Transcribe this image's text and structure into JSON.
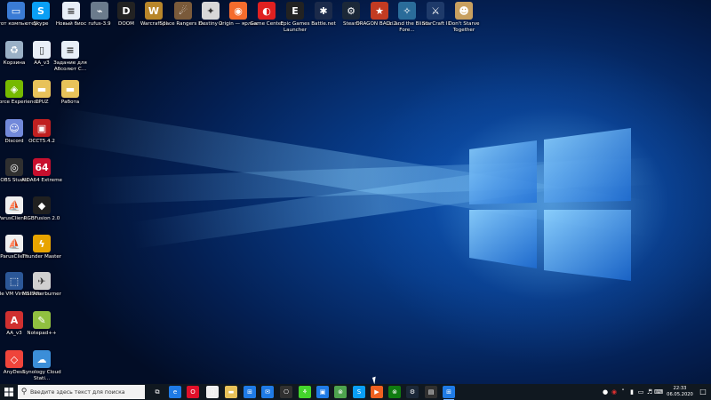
{
  "desktop_icons": [
    {
      "label": "Этот компьютер",
      "icon": "computer-icon",
      "color": "#3a7bd5"
    },
    {
      "label": "Skype",
      "icon": "skype-icon",
      "color": "#0a9ff5"
    },
    {
      "label": "Новый биос",
      "icon": "document-icon",
      "color": "#e8eef7"
    },
    {
      "label": "rufus-3.9",
      "icon": "usb-drive-icon",
      "color": "#6b7b8c"
    },
    {
      "label": "DOOM",
      "icon": "doom-logo-icon",
      "color": "#222222"
    },
    {
      "label": "Warcraft III",
      "icon": "warcraft-icon",
      "color": "#b8862a"
    },
    {
      "label": "Space Rangers H...",
      "icon": "space-rangers-icon",
      "color": "#7a5a3a"
    },
    {
      "label": "Destiny 2",
      "icon": "destiny-icon",
      "color": "#d8d8d8"
    },
    {
      "label": "Origin — ярлык",
      "icon": "origin-icon",
      "color": "#f56c2d"
    },
    {
      "label": "Game Center",
      "icon": "game-center-icon",
      "color": "#e02020"
    },
    {
      "label": "Epic Games Launcher",
      "icon": "epic-games-icon",
      "color": "#222222"
    },
    {
      "label": "Battle.net",
      "icon": "battlenet-icon",
      "color": "#1b2a4a"
    },
    {
      "label": "Steam",
      "icon": "steam-icon",
      "color": "#1b2838"
    },
    {
      "label": "DRAGON BALL Z ...",
      "icon": "dragon-ball-icon",
      "color": "#c23b22"
    },
    {
      "label": "Ori and the Blind Fore...",
      "icon": "ori-icon",
      "color": "#2a6c9a"
    },
    {
      "label": "StarCraft II",
      "icon": "starcraft-icon",
      "color": "#1e3a6a"
    },
    {
      "label": "Don't Starve Together",
      "icon": "dont-starve-icon",
      "color": "#c8a060"
    },
    {
      "label": "Корзина",
      "icon": "recycle-bin-icon",
      "color": "#9ab0c6"
    },
    {
      "label": "AA_v3",
      "icon": "file-icon",
      "color": "#e8eef7"
    },
    {
      "label": "Задание для Абсолют С...",
      "icon": "document-icon",
      "color": "#e8eef7"
    },
    {
      "label": "GeForce Experience",
      "icon": "geforce-icon",
      "color": "#76b900"
    },
    {
      "label": "CPUZ",
      "icon": "folder-icon",
      "color": "#e8c25a"
    },
    {
      "label": "Работа",
      "icon": "folder-icon",
      "color": "#e8c25a"
    },
    {
      "label": "Discord",
      "icon": "discord-icon",
      "color": "#7289da"
    },
    {
      "label": "OCCT5.4.2",
      "icon": "occt-icon",
      "color": "#c02020"
    },
    {
      "label": "OBS Studio",
      "icon": "obs-icon",
      "color": "#303030"
    },
    {
      "label": "AIDA64 Extreme",
      "icon": "aida64-icon",
      "color": "#c8102e"
    },
    {
      "label": "ParusClient...",
      "icon": "parus-icon",
      "color": "#f0f0f0"
    },
    {
      "label": "RGBFusion 2.0",
      "icon": "rgb-fusion-icon",
      "color": "#202020"
    },
    {
      "label": "ParusClient",
      "icon": "parus-icon",
      "color": "#f0f0f0"
    },
    {
      "label": "Thunder Master",
      "icon": "thunder-master-icon",
      "color": "#e8a400"
    },
    {
      "label": "Oracle VM VirtualBox",
      "icon": "virtualbox-icon",
      "color": "#2b5797"
    },
    {
      "label": "MSI Afterburner",
      "icon": "msi-afterburner-icon",
      "color": "#d0d0d0"
    },
    {
      "label": "AA_v3",
      "icon": "aa-v3-icon",
      "color": "#d03030"
    },
    {
      "label": "Notepad++",
      "icon": "notepadpp-icon",
      "color": "#90c040"
    },
    {
      "label": "AnyDesk",
      "icon": "anydesk-icon",
      "color": "#ef443b"
    },
    {
      "label": "Synology Cloud Stati...",
      "icon": "synology-icon",
      "color": "#3b8ed8"
    }
  ],
  "taskbar": {
    "search_placeholder": "Введите здесь текст для поиска",
    "apps": [
      {
        "name": "task-view",
        "icon": "task-view-icon",
        "color": "#101820"
      },
      {
        "name": "edge",
        "icon": "edge-icon",
        "color": "#1f7be6"
      },
      {
        "name": "opera",
        "icon": "opera-icon",
        "color": "#e0102a"
      },
      {
        "name": "tablet",
        "icon": "tablet-icon",
        "color": "#f0f0f0"
      },
      {
        "name": "file-explorer",
        "icon": "file-explorer-icon",
        "color": "#e8c25a"
      },
      {
        "name": "store",
        "icon": "store-icon",
        "color": "#1f7be6"
      },
      {
        "name": "mail",
        "icon": "mail-icon",
        "color": "#1f7be6"
      },
      {
        "name": "game",
        "icon": "gamepad-icon",
        "color": "#303030"
      },
      {
        "name": "razer",
        "icon": "razer-icon",
        "color": "#44d62c"
      },
      {
        "name": "photos",
        "icon": "photos-icon",
        "color": "#1f7be6"
      },
      {
        "name": "xbox",
        "icon": "xbox-icon",
        "color": "#4ea44e"
      },
      {
        "name": "skype",
        "icon": "skype-icon",
        "color": "#0a9ff5"
      },
      {
        "name": "media",
        "icon": "media-icon",
        "color": "#f06020"
      },
      {
        "name": "xbox-app",
        "icon": "xbox-icon",
        "color": "#107c10"
      },
      {
        "name": "steam",
        "icon": "steam-icon",
        "color": "#1b2838"
      },
      {
        "name": "terminal",
        "icon": "terminal-icon",
        "color": "#303030"
      },
      {
        "name": "store-app",
        "icon": "store-icon",
        "color": "#1f7be6"
      },
      {
        "name": "obs",
        "icon": "obs-icon",
        "color": "#303030"
      }
    ],
    "tray_icons": [
      "people-icon",
      "antivirus-icon",
      "chevron-up-icon",
      "battery-icon",
      "network-icon",
      "volume-icon",
      "language-icon"
    ],
    "clock_time": "22:33",
    "clock_date": "06.05.2020"
  }
}
